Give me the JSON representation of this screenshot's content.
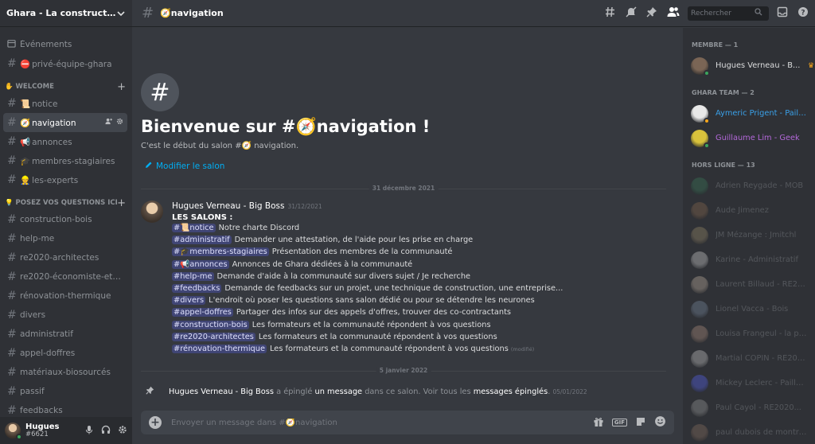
{
  "server": {
    "name": "Ghara - La construction ..."
  },
  "sidebar": {
    "top_items": [
      {
        "icon": "calendar-icon",
        "label": "Événements"
      },
      {
        "icon": "hash-icon",
        "emoji": "⛔",
        "label": "privé-équipe-ghara"
      }
    ],
    "categories": [
      {
        "label": "✋ WELCOME",
        "items": [
          {
            "emoji": "📜",
            "label": "notice"
          },
          {
            "emoji": "🧭",
            "label": "navigation",
            "active": true
          },
          {
            "emoji": "📢",
            "label": "annonces"
          },
          {
            "emoji": "🎓",
            "label": "membres-stagiaires"
          },
          {
            "emoji": "👷",
            "label": "les-experts"
          }
        ]
      },
      {
        "label": "💡 POSEZ VOS QUESTIONS ICI :",
        "items": [
          {
            "label": "construction-bois"
          },
          {
            "label": "help-me"
          },
          {
            "label": "re2020-architectes"
          },
          {
            "label": "re2020-économiste-et-be"
          },
          {
            "label": "rénovation-thermique"
          },
          {
            "label": "divers"
          },
          {
            "label": "administratif"
          },
          {
            "label": "appel-doffres"
          },
          {
            "label": "matériaux-biosourcés"
          },
          {
            "label": "passif"
          },
          {
            "label": "feedbacks"
          }
        ]
      }
    ]
  },
  "user": {
    "name": "Hugues",
    "tag": "#6621"
  },
  "topbar": {
    "channel": "🧭navigation",
    "search_placeholder": "Rechercher"
  },
  "welcome": {
    "title": "Bienvenue sur #🧭navigation !",
    "subtitle": "C'est le début du salon #🧭 navigation.",
    "edit_label": "Modifier le salon"
  },
  "dividers": {
    "first": "31 décembre 2021",
    "second": "5 janvier 2022"
  },
  "message": {
    "author": "Hugues Verneau - Big Boss",
    "date": "31/12/2021",
    "heading": "LES SALONS :",
    "lines": [
      {
        "mention": "#📜notice",
        "text": "Notre charte Discord"
      },
      {
        "mention": "#administratif",
        "text": "Demander une attestation, de l'aide pour les prise en charge"
      },
      {
        "mention": "#🎓membres-stagiaires",
        "text": "Présentation des membres de la communauté"
      },
      {
        "mention": "#📢annonces",
        "text": "Annonces de Ghara dédiées à la communauté"
      },
      {
        "mention": "#help-me",
        "text": "Demande d'aide à la communauté sur divers sujet / Je recherche"
      },
      {
        "mention": "#feedbacks",
        "text": "Demande de feedbacks sur un projet, une technique de construction, une entreprise..."
      },
      {
        "mention": "#divers",
        "text": "L'endroit où poser les questions sans salon dédié ou pour se détendre les neurones"
      },
      {
        "mention": "#appel-doffres",
        "text": "Partager des infos sur des appels d'offres, trouver des co-contractants"
      },
      {
        "mention": "#construction-bois",
        "text": "Les formateurs et la communauté répondent à vos questions"
      },
      {
        "mention": "#re2020-architectes",
        "text": "Les formateurs et la communauté répondent à vos questions"
      },
      {
        "mention": "#rénovation-thermique",
        "text": "Les formateurs et la communauté répondent à vos questions",
        "edited": "(modifié)"
      }
    ]
  },
  "pin": {
    "author": "Hugues Verneau - Big Boss",
    "t1": "a épinglé",
    "link1": "un message",
    "t2": "dans ce salon. Voir tous les",
    "link2": "messages épinglés",
    "t3": ".",
    "date": "05/01/2022"
  },
  "composer": {
    "placeholder": "Envoyer un message dans #🧭navigation",
    "gif": "GIF"
  },
  "members": {
    "groups": [
      {
        "label": "MEMBRE — 1",
        "items": [
          {
            "name": "Hugues Verneau - B...",
            "color": "#dcddde",
            "status": "#3ba55d",
            "crown": "♛",
            "avatar": "#7a6555"
          }
        ]
      },
      {
        "label": "GHARA TEAM — 2",
        "items": [
          {
            "name": "Aymeric Prigent - Paill...",
            "color": "#3aa0e8",
            "status": "#faa61a",
            "avatar": "#e8e8e8"
          },
          {
            "name": "Guillaume Lim - Geek",
            "color": "#b368d9",
            "status": "#3ba55d",
            "avatar": "#d9c23c"
          }
        ]
      },
      {
        "label": "HORS LIGNE — 13",
        "offline": true,
        "items": [
          {
            "name": "Adrien Reygade - MOB",
            "avatar": "#3a7a5a"
          },
          {
            "name": "Aude Jimenez",
            "avatar": "#8a6a50"
          },
          {
            "name": "JM Mézange : Jmitchl",
            "avatar": "#9a8a6a"
          },
          {
            "name": "Karine - Administratif",
            "avatar": "#d0d0d0"
          },
          {
            "name": "Laurent Billaud - RE20...",
            "avatar": "#c0b0a0"
          },
          {
            "name": "Lionel Vacca - Bois",
            "avatar": "#7a8aa0"
          },
          {
            "name": "Louisa Frangeul - la po...",
            "avatar": "#b09080"
          },
          {
            "name": "Martial COPIN - RE202...",
            "avatar": "#c8c8c8"
          },
          {
            "name": "Mickey Leclerc - Paille...",
            "avatar": "#5865f2"
          },
          {
            "name": "Paul Cayol - RE2020...",
            "avatar": "#9a9a9a"
          },
          {
            "name": "paul dubois de montre...",
            "avatar": "#8a7060"
          }
        ]
      }
    ]
  }
}
